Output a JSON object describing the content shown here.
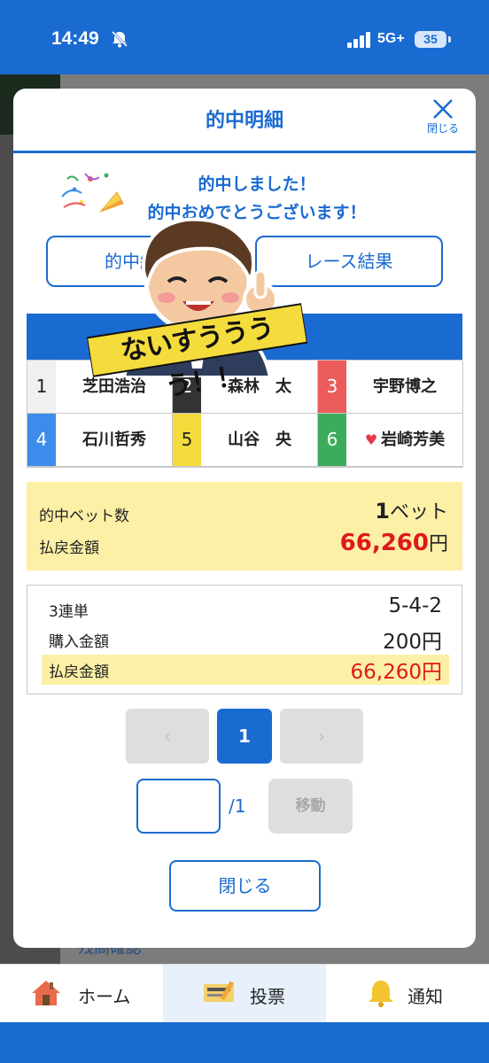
{
  "status_bar": {
    "time": "14:49",
    "network": "5G+",
    "battery": "35"
  },
  "background": {
    "partial_text": "残高確認"
  },
  "modal": {
    "title": "的中明細",
    "close_icon_label": "閉じる",
    "congrats_line1": "的中しました！",
    "congrats_line2": "的中おめでとうございます！",
    "tabs": [
      "的中結果",
      "レース結果"
    ]
  },
  "sticker_text": "ないすうううう！！",
  "racers": [
    {
      "num": "1",
      "name": "芝田浩治",
      "bg": "#f0f0f0",
      "fg": "#222222",
      "heart": false
    },
    {
      "num": "2",
      "name": "森林　太",
      "bg": "#333333",
      "fg": "#ffffff",
      "heart": false
    },
    {
      "num": "3",
      "name": "宇野博之",
      "bg": "#ec5c5c",
      "fg": "#ffffff",
      "heart": false
    },
    {
      "num": "4",
      "name": "石川哲秀",
      "bg": "#3c8cec",
      "fg": "#ffffff",
      "heart": false
    },
    {
      "num": "5",
      "name": "山谷　央",
      "bg": "#f4dc3c",
      "fg": "#222222",
      "heart": false
    },
    {
      "num": "6",
      "name": "岩崎芳美",
      "bg": "#3cac5c",
      "fg": "#ffffff",
      "heart": true
    }
  ],
  "summary": {
    "bets_label": "的中ベット数",
    "bets_value": "1",
    "bets_unit": "ベット",
    "payout_label": "払戻金額",
    "payout_value": "66,260",
    "payout_unit": "円"
  },
  "detail": {
    "rows": [
      {
        "label": "3連単",
        "value": "5-4-2"
      },
      {
        "label": "購入金額",
        "value": "200円"
      },
      {
        "label": "払戻金額",
        "value": "66,260円"
      }
    ]
  },
  "pagination": {
    "prev": "‹",
    "current": "1",
    "next": "›",
    "total": "/1",
    "move": "移動"
  },
  "close_button": "閉じる",
  "bottom_nav": [
    {
      "label": "ホーム",
      "icon": "home-icon"
    },
    {
      "label": "投票",
      "icon": "ticket-icon"
    },
    {
      "label": "通知",
      "icon": "bell-icon"
    }
  ],
  "colors": {
    "primary": "#1a6bd1",
    "highlight": "#fcf0a6",
    "payout": "#e0181e"
  }
}
